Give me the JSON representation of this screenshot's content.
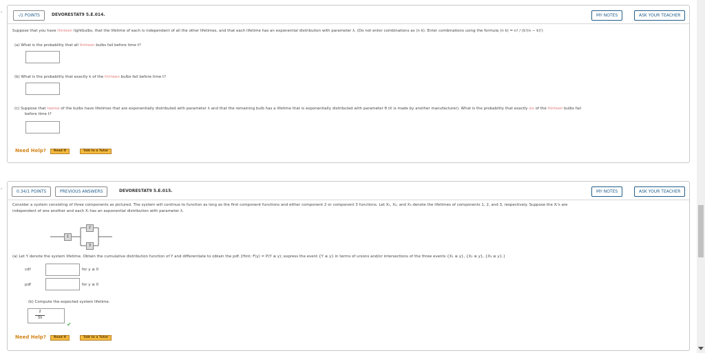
{
  "q1": {
    "number": "-",
    "points": "-/1 POINTS",
    "id": "DEVORESTAT9 5.E.014.",
    "my_notes": "MY NOTES",
    "ask_teacher": "ASK YOUR TEACHER",
    "intro_a": "Suppose that you have ",
    "intro_hl": "thirteen",
    "intro_b": " lightbulbs, that the lifetime of each is independent of all the other lifetimes, and that each lifetime has an exponential distribution with parameter λ. (Do not enter combinations as ",
    "intro_c": ". Enter combinations using the formula ",
    "comb_symbol": "(n k)",
    "formula": "n! / (k!(n − k)!)",
    "part_a_a": "(a)  What is the probability that all ",
    "part_a_hl": "thirteen",
    "part_a_b": " bulbs fail before time t?",
    "part_b_a": "(b)  What is the probability that exactly k of the ",
    "part_b_hl": "thirteen",
    "part_b_b": " bulbs fail before time t?",
    "part_c_a": "(c)  Suppose that ",
    "part_c_hl": "twelve",
    "part_c_b": " of the bulbs have lifetimes that are exponentially distributed with parameter λ and that the remaining bulb has a lifetime that is exponentially distributed with parameter θ (it is made by another manufacturer). What is the probability that exactly ",
    "part_c_hl2": "six",
    "part_c_c": " of the ",
    "part_c_hl3": "thirteen",
    "part_c_d": " bulbs fail",
    "part_c_e": "before time t?",
    "need_help": "Need Help?",
    "read_it": "Read It",
    "talk_tutor": "Talk to a Tutor"
  },
  "q2": {
    "number": "-",
    "points": "0.34/1 POINTS",
    "previous": "PREVIOUS ANSWERS",
    "id": "DEVORESTAT9 5.E.015.",
    "my_notes": "MY NOTES",
    "ask_teacher": "ASK YOUR TEACHER",
    "intro_1": "Consider a system consisting of three components as pictured. The system will continue to function as long as the first component functions and either component 2 or component 3 functions. Let X₁, X₂, and X₃ denote the lifetimes of components 1, 2, and 3, respectively. Suppose the Xᵢ's are",
    "intro_2": "independent of one another and each Xᵢ has an exponential distribution with parameter λ.",
    "node1": "1",
    "node2": "2",
    "node3": "3",
    "part_a": "(a)  Let Y denote the system lifetime. Obtain the cumulative distribution function of Y and differentiate to obtain the pdf. [Hint: F(y) = P(Y ≤ y); express the event {Y ≤ y} in terms of unions and/or intersections of the three events {X₁ ≤ y}, {X₂ ≤ y}, {X₃ ≤ y}.]",
    "cdf_label": "cdf",
    "pdf_label": "pdf",
    "cdf_cond": "for y ≥ 0",
    "pdf_cond": "for y ≥ 0",
    "part_b": "(b)  Compute the expected system lifetime.",
    "answer_num": "2",
    "answer_den": "3λ",
    "check": "✔",
    "need_help": "Need Help?",
    "read_it": "Read It",
    "talk_tutor": "Talk to a Tutor"
  }
}
